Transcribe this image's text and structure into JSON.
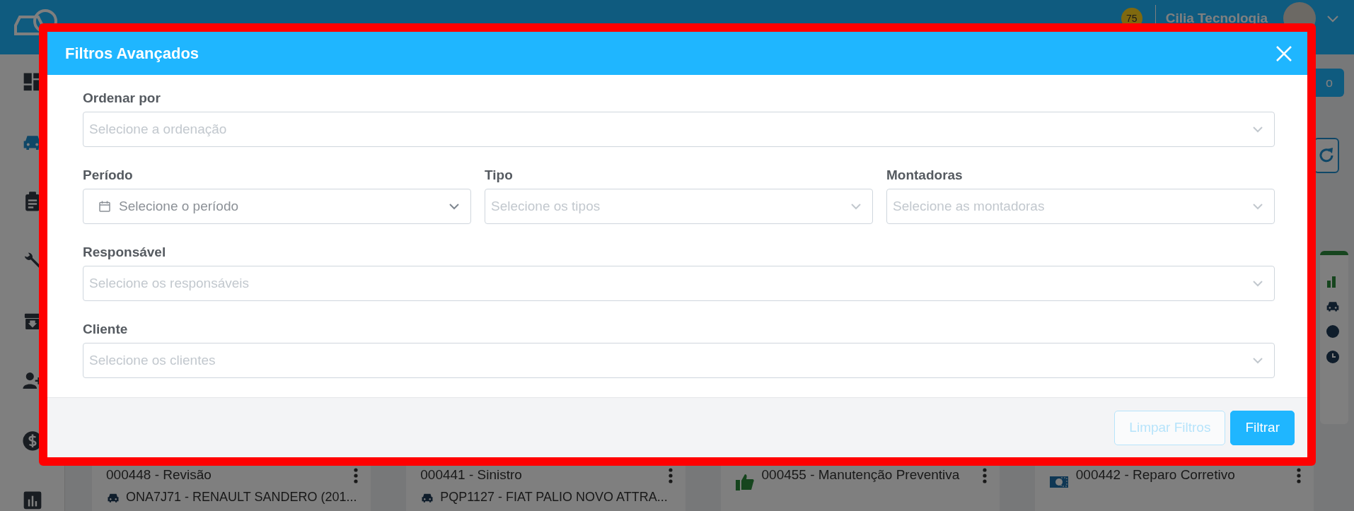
{
  "topbar": {
    "notification_count": "75",
    "company": "Cilia Tecnologia"
  },
  "sidebar": {
    "items": [
      {
        "selected": false
      },
      {
        "selected": true
      },
      {
        "selected": false
      },
      {
        "selected": false
      },
      {
        "selected": false
      },
      {
        "selected": false
      },
      {
        "selected": false
      },
      {
        "selected": false
      }
    ]
  },
  "top_button": {
    "label": "o"
  },
  "cards": [
    {
      "title": "000448 - Revisão",
      "vehicle": "ONA7J71 - RENAULT SANDERO (201...",
      "kind": "plain"
    },
    {
      "title": "000441 - Sinistro",
      "vehicle": "PQP1127 - FIAT PALIO NOVO ATTRA...",
      "kind": "plain"
    },
    {
      "title": "000455 - Manutenção Preventiva",
      "kind": "thumbs"
    },
    {
      "title": "000442 - Reparo Corretivo",
      "kind": "money"
    }
  ],
  "modal": {
    "title": "Filtros Avançados",
    "rows": [
      [
        {
          "label": "Ordenar por",
          "placeholder": "Selecione a ordenação",
          "kind": "select"
        }
      ],
      [
        {
          "label": "Período",
          "placeholder": "Selecione o período",
          "kind": "date"
        },
        {
          "label": "Tipo",
          "placeholder": "Selecione os tipos",
          "kind": "select"
        },
        {
          "label": "Montadoras",
          "placeholder": "Selecione as montadoras",
          "kind": "select"
        }
      ],
      [
        {
          "label": "Responsável",
          "placeholder": "Selecione os responsáveis",
          "kind": "select"
        }
      ],
      [
        {
          "label": "Cliente",
          "placeholder": "Selecione os clientes",
          "kind": "select"
        }
      ]
    ],
    "buttons": [
      {
        "label": "Limpar Filtros",
        "disabled": true
      },
      {
        "label": "Filtrar",
        "disabled": false
      }
    ]
  }
}
